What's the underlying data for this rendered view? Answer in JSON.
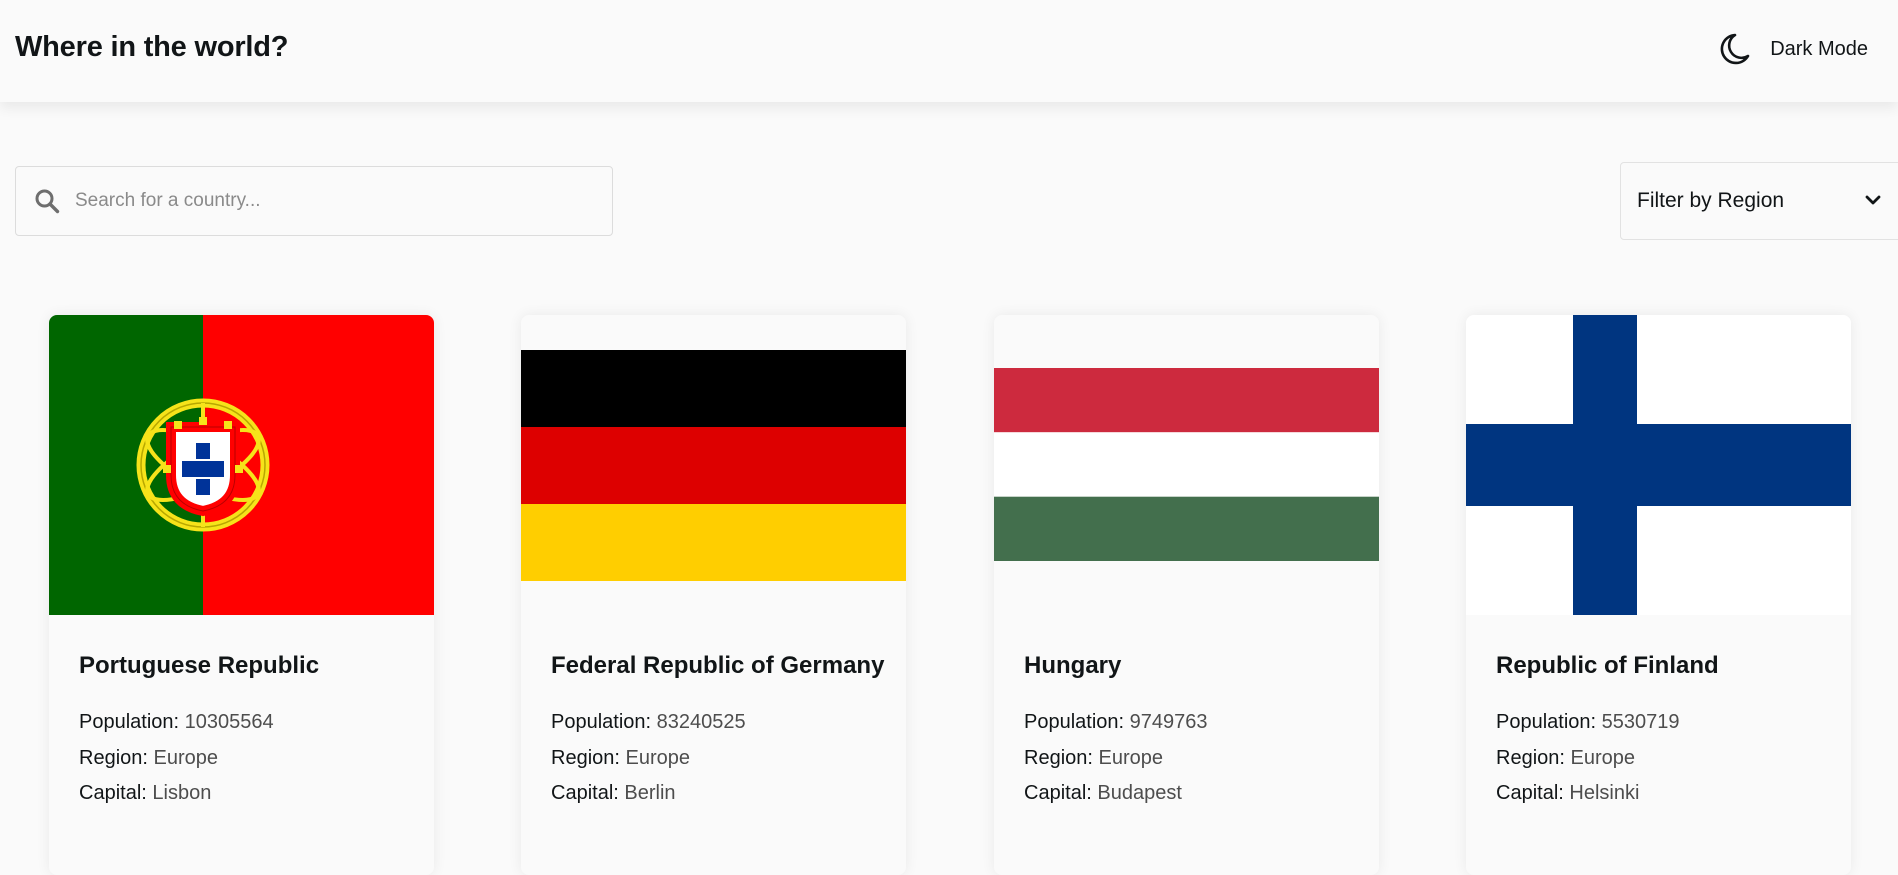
{
  "header": {
    "title": "Where in the world?",
    "theme_toggle_label": "Dark Mode",
    "theme_toggle_icon": "moon-icon"
  },
  "search": {
    "placeholder": "Search for a country...",
    "value": "",
    "icon": "search-icon"
  },
  "filter": {
    "label": "Filter by Region",
    "icon": "chevron-down-icon"
  },
  "field_labels": {
    "population": "Population:",
    "region": "Region:",
    "capital": "Capital:"
  },
  "countries": [
    {
      "name": "Portuguese Republic",
      "population": "10305564",
      "region": "Europe",
      "capital": "Lisbon",
      "flag": "portugal-flag"
    },
    {
      "name": "Federal Republic of Germany",
      "population": "83240525",
      "region": "Europe",
      "capital": "Berlin",
      "flag": "germany-flag"
    },
    {
      "name": "Hungary",
      "population": "9749763",
      "region": "Europe",
      "capital": "Budapest",
      "flag": "hungary-flag"
    },
    {
      "name": "Republic of Finland",
      "population": "5530719",
      "region": "Europe",
      "capital": "Helsinki",
      "flag": "finland-flag"
    }
  ],
  "colors": {
    "background": "#fafafa",
    "text": "#111517",
    "value_text": "#4d4d4d"
  }
}
